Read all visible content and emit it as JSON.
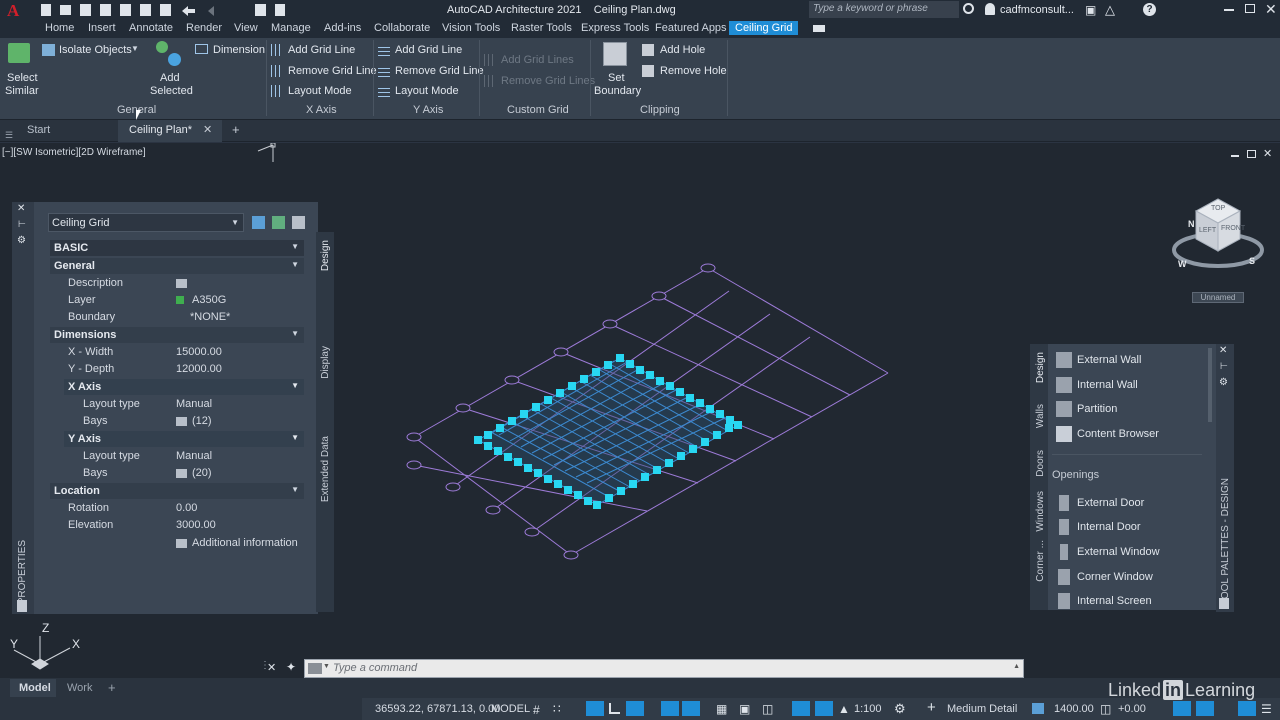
{
  "app": {
    "title": "AutoCAD Architecture 2021",
    "document": "Ceiling Plan.dwg",
    "search_placeholder": "Type a keyword or phrase",
    "user": "cadfmconsult...",
    "logo_letter": "A"
  },
  "menu": [
    "Home",
    "Insert",
    "Annotate",
    "Render",
    "View",
    "Manage",
    "Add-ins",
    "Collaborate",
    "Vision Tools",
    "Raster Tools",
    "Express Tools",
    "Featured Apps",
    "Ceiling Grid"
  ],
  "ribbon": {
    "general": {
      "label": "General",
      "select_similar": [
        "Select",
        "Similar"
      ],
      "isolate_objects": "Isolate Objects",
      "add_selected": [
        "Add",
        "Selected"
      ],
      "dimension": "Dimension"
    },
    "x_axis": {
      "label": "X Axis",
      "add": "Add Grid Line",
      "remove": "Remove Grid Line",
      "layout": "Layout Mode"
    },
    "y_axis": {
      "label": "Y Axis",
      "add": "Add Grid Line",
      "remove": "Remove Grid Line",
      "layout": "Layout Mode"
    },
    "custom_grid": {
      "label": "Custom Grid",
      "add": "Add Grid Lines",
      "remove": "Remove Grid Lines"
    },
    "clipping": {
      "label": "Clipping",
      "set_boundary": [
        "Set",
        "Boundary"
      ],
      "add_hole": "Add Hole",
      "remove_hole": "Remove Hole"
    }
  },
  "doc_tabs": {
    "start": "Start",
    "current": "Ceiling Plan*"
  },
  "viewport_label": "[−][SW Isometric][2D Wireframe]",
  "properties": {
    "object_type": "Ceiling Grid",
    "basic": "BASIC",
    "general": "General",
    "description_label": "Description",
    "layer_label": "Layer",
    "layer_value": "A350G",
    "boundary_label": "Boundary",
    "boundary_value": "*NONE*",
    "dimensions": "Dimensions",
    "xwidth_label": "X - Width",
    "xwidth_value": "15000.00",
    "ydepth_label": "Y - Depth",
    "ydepth_value": "12000.00",
    "xaxis": "X Axis",
    "yaxis": "Y Axis",
    "layout_type_label": "Layout type",
    "x_layout_value": "Manual",
    "bays_label": "Bays",
    "x_bays_value": "(12)",
    "y_layout_value": "Manual",
    "y_bays_value": "(20)",
    "location": "Location",
    "rotation_label": "Rotation",
    "rotation_value": "0.00",
    "elevation_label": "Elevation",
    "elevation_value": "3000.00",
    "additional": "Additional information",
    "side_tabs": [
      "Design",
      "Display",
      "Extended Data"
    ],
    "palette_title": "PROPERTIES"
  },
  "viewcube": {
    "top": "TOP",
    "left": "LEFT",
    "front": "FRONT",
    "w": "W",
    "s": "S",
    "n": "N",
    "ucs": "Unnamed"
  },
  "tool_palette": {
    "title": "TOOL PALETTES - DESIGN",
    "tabs": [
      "Design",
      "Walls",
      "Doors",
      "Windows",
      "Corner ..."
    ],
    "items_top": [
      "External Wall",
      "Internal Wall",
      "Partition",
      "Content Browser"
    ],
    "section": "Openings",
    "items_bottom": [
      "External Door",
      "Internal Door",
      "External Window",
      "Corner Window",
      "Internal Screen"
    ]
  },
  "command": {
    "placeholder": "Type a command"
  },
  "ucs_icon": {
    "x": "X",
    "y": "Y",
    "z": "Z"
  },
  "layout_tabs": [
    "Model",
    "Work"
  ],
  "status": {
    "coords": "36593.22, 67871.13, 0.00",
    "space": "MODEL",
    "scale": "1:100",
    "detail": "Medium Detail",
    "cut_plane": "1400.00",
    "elev": "+0.00"
  },
  "watermark": {
    "a": "Linked",
    "b": "in",
    "c": "Learning"
  }
}
